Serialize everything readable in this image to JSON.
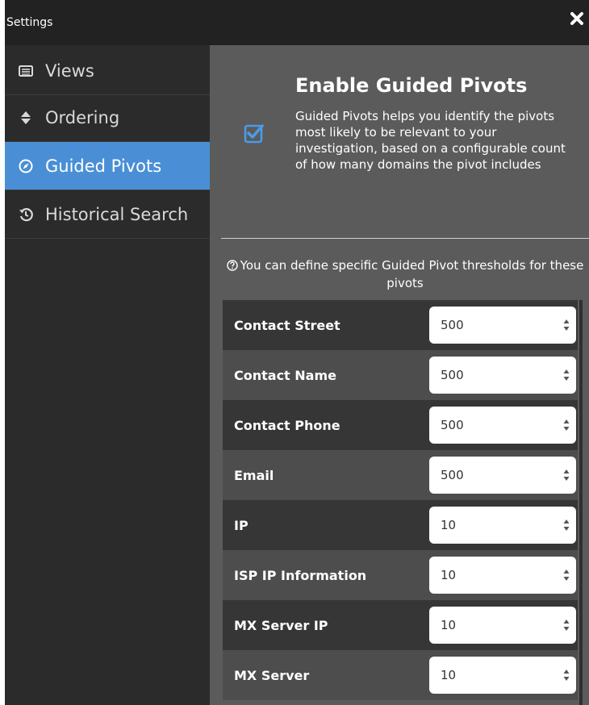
{
  "window": {
    "title": "Settings"
  },
  "sidebar": {
    "items": [
      {
        "label": "Views",
        "icon": "list-icon",
        "active": false
      },
      {
        "label": "Ordering",
        "icon": "sort-icon",
        "active": false
      },
      {
        "label": "Guided Pivots",
        "icon": "compass-icon",
        "active": true
      },
      {
        "label": "Historical Search",
        "icon": "history-icon",
        "active": false
      }
    ]
  },
  "main": {
    "title": "Enable Guided Pivots",
    "description": "Guided Pivots helps you identify the pivots most likely to be relevant to your investigation, based on a configurable count of how many domains the pivot includes",
    "enabled": true,
    "help_text": "You can define specific Guided Pivot thresholds for these pivots",
    "thresholds": [
      {
        "label": "Contact Street",
        "value": "500"
      },
      {
        "label": "Contact Name",
        "value": "500"
      },
      {
        "label": "Contact Phone",
        "value": "500"
      },
      {
        "label": "Email",
        "value": "500"
      },
      {
        "label": "IP",
        "value": "10"
      },
      {
        "label": "ISP IP Information",
        "value": "10"
      },
      {
        "label": "MX Server IP",
        "value": "10"
      },
      {
        "label": "MX Server",
        "value": "10"
      }
    ]
  },
  "colors": {
    "accent": "#4a8fd6",
    "checkbox": "#4a9be8",
    "sidebar_bg": "#2b2b2b",
    "panel_bg": "#5b5b5b"
  }
}
